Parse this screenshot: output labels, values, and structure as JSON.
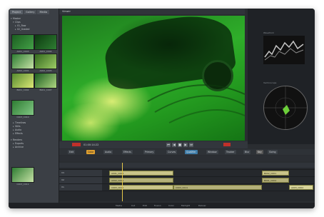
{
  "app": {
    "accent": "#e6c84a",
    "record_color": "#c0302a"
  },
  "left_panel": {
    "tabs": [
      "Project",
      "Gallery",
      "Media"
    ],
    "tree": [
      "Master",
      "Clips",
      "01_Raw",
      "02_Graded",
      "Timelines",
      "Stills",
      "Audio",
      "Effects",
      "Renders",
      "Exports",
      "Archive"
    ],
    "thumbs": [
      {
        "caption": "A001_C003"
      },
      {
        "caption": "A001_C004"
      },
      {
        "caption": "A002_C001"
      },
      {
        "caption": "A002_C005"
      },
      {
        "caption": "B001_C002"
      },
      {
        "caption": "B001_C007"
      },
      {
        "caption": "C003_C010"
      },
      {
        "caption": "C003_C011"
      }
    ]
  },
  "viewer": {
    "title": "Viewer"
  },
  "scopes": {
    "waveform_label": "Waveform",
    "vector_label": "Vectorscope"
  },
  "transport": {
    "timecode": "01:00:14:22"
  },
  "toolbar": {
    "buttons": [
      "Edit",
      "Color",
      "Audio",
      "Effects",
      "Primary",
      "Curves",
      "Qualifier",
      "Window",
      "Tracker",
      "Blur",
      "Key",
      "Sizing"
    ]
  },
  "timeline": {
    "tracks": [
      {
        "name": "V3",
        "clips": [
          {
            "label": "A001_C003",
            "color": "#c9c48a"
          },
          {
            "label": "B002_C001",
            "color": "#c9c48a"
          }
        ]
      },
      {
        "name": "V2",
        "clips": [
          {
            "label": "A002_C005",
            "color": "#c9c48a"
          },
          {
            "label": "B001_C004",
            "color": "#c9c48a"
          }
        ]
      },
      {
        "name": "V1",
        "clips": [
          {
            "label": "C003_C010",
            "color": "#c9c48a"
          },
          {
            "label": "C003_C011",
            "color": "#c9c48a"
          },
          {
            "label": "A003_C002",
            "color": "#d8d49a"
          }
        ]
      }
    ]
  },
  "statusbar": {
    "items": [
      "Media",
      "Cut",
      "Edit",
      "Fusion",
      "Color",
      "Fairlight",
      "Deliver"
    ]
  }
}
